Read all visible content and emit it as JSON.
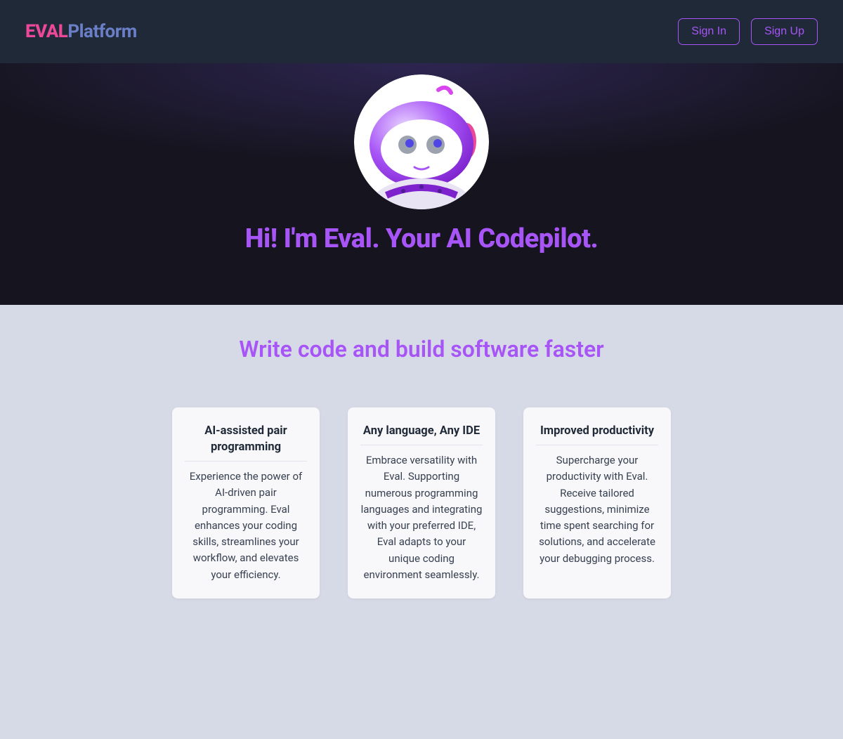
{
  "header": {
    "logo_eval": "EVAL",
    "logo_platform": "Platform",
    "sign_in": "Sign In",
    "sign_up": "Sign Up"
  },
  "hero": {
    "title": "Hi! I'm Eval. Your AI Codepilot."
  },
  "features": {
    "title": "Write code and build software faster",
    "cards": [
      {
        "title": "AI-assisted pair programming",
        "description": "Experience the power of AI-driven pair programming. Eval enhances your coding skills, streamlines your workflow, and elevates your efficiency."
      },
      {
        "title": "Any language, Any IDE",
        "description": "Embrace versatility with Eval. Supporting numerous programming languages and integrating with your preferred IDE, Eval adapts to your unique coding environment seamlessly."
      },
      {
        "title": "Improved productivity",
        "description": "Supercharge your productivity with Eval. Receive tailored suggestions, minimize time spent searching for solutions, and accelerate your debugging process."
      }
    ]
  }
}
